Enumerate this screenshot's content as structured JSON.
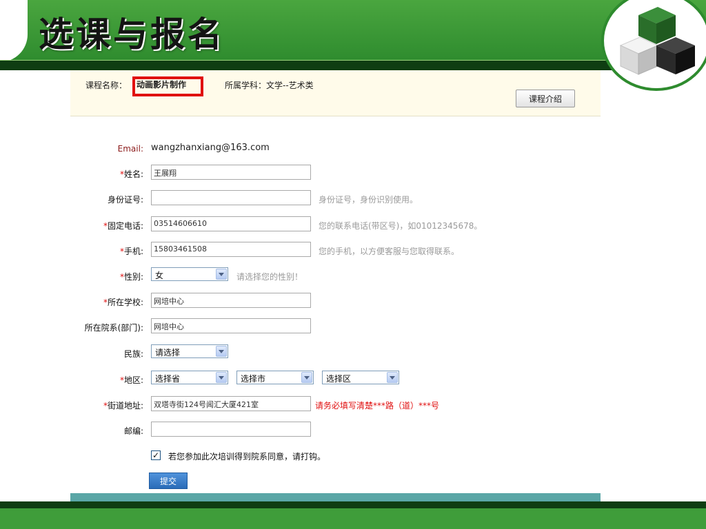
{
  "slide": {
    "title": "选课与报名"
  },
  "course": {
    "name_label": "课程名称：",
    "name": "动画影片制作",
    "subject": "所属学科：文学--艺术类",
    "intro_button": "课程介绍"
  },
  "form": {
    "email": {
      "label": "Email:",
      "value": "wangzhanxiang@163.com"
    },
    "name": {
      "required": "*",
      "label": "姓名:",
      "value": "王展翔"
    },
    "id_card": {
      "label": "身份证号:",
      "value": "",
      "hint": "身份证号，身份识别使用。"
    },
    "phone": {
      "required": "*",
      "label": "固定电话:",
      "value": "03514606610",
      "hint": "您的联系电话(带区号)，如01012345678。"
    },
    "mobile": {
      "required": "*",
      "label": "手机:",
      "value": "15803461508",
      "hint": "您的手机，以方便客服与您取得联系。"
    },
    "gender": {
      "required": "*",
      "label": "性别:",
      "value": "女",
      "hint": "请选择您的性别！"
    },
    "school": {
      "required": "*",
      "label": "所在学校:",
      "value": "网培中心"
    },
    "department": {
      "label": "所在院系(部门):",
      "value": "网培中心"
    },
    "ethnicity": {
      "label": "民族:",
      "value": "请选择"
    },
    "region": {
      "required": "*",
      "label": "地区:",
      "province": "选择省",
      "city": "选择市",
      "district": "选择区"
    },
    "address": {
      "required": "*",
      "label": "街道地址:",
      "value": "双塔寺街124号闻汇大厦421室",
      "hint": "请务必填写清楚***路（道）***号"
    },
    "postcode": {
      "label": "邮编:",
      "value": ""
    },
    "consent": {
      "mark": "✓",
      "label": "若您参加此次培训得到院系同意，请打钩。"
    },
    "submit": "提交"
  },
  "colors": {
    "band_green": "#3f9d3a",
    "band_dark": "#0f3d12",
    "required": "#e01010",
    "hint": "#9a9a9a",
    "teal": "#5aa6a6"
  }
}
